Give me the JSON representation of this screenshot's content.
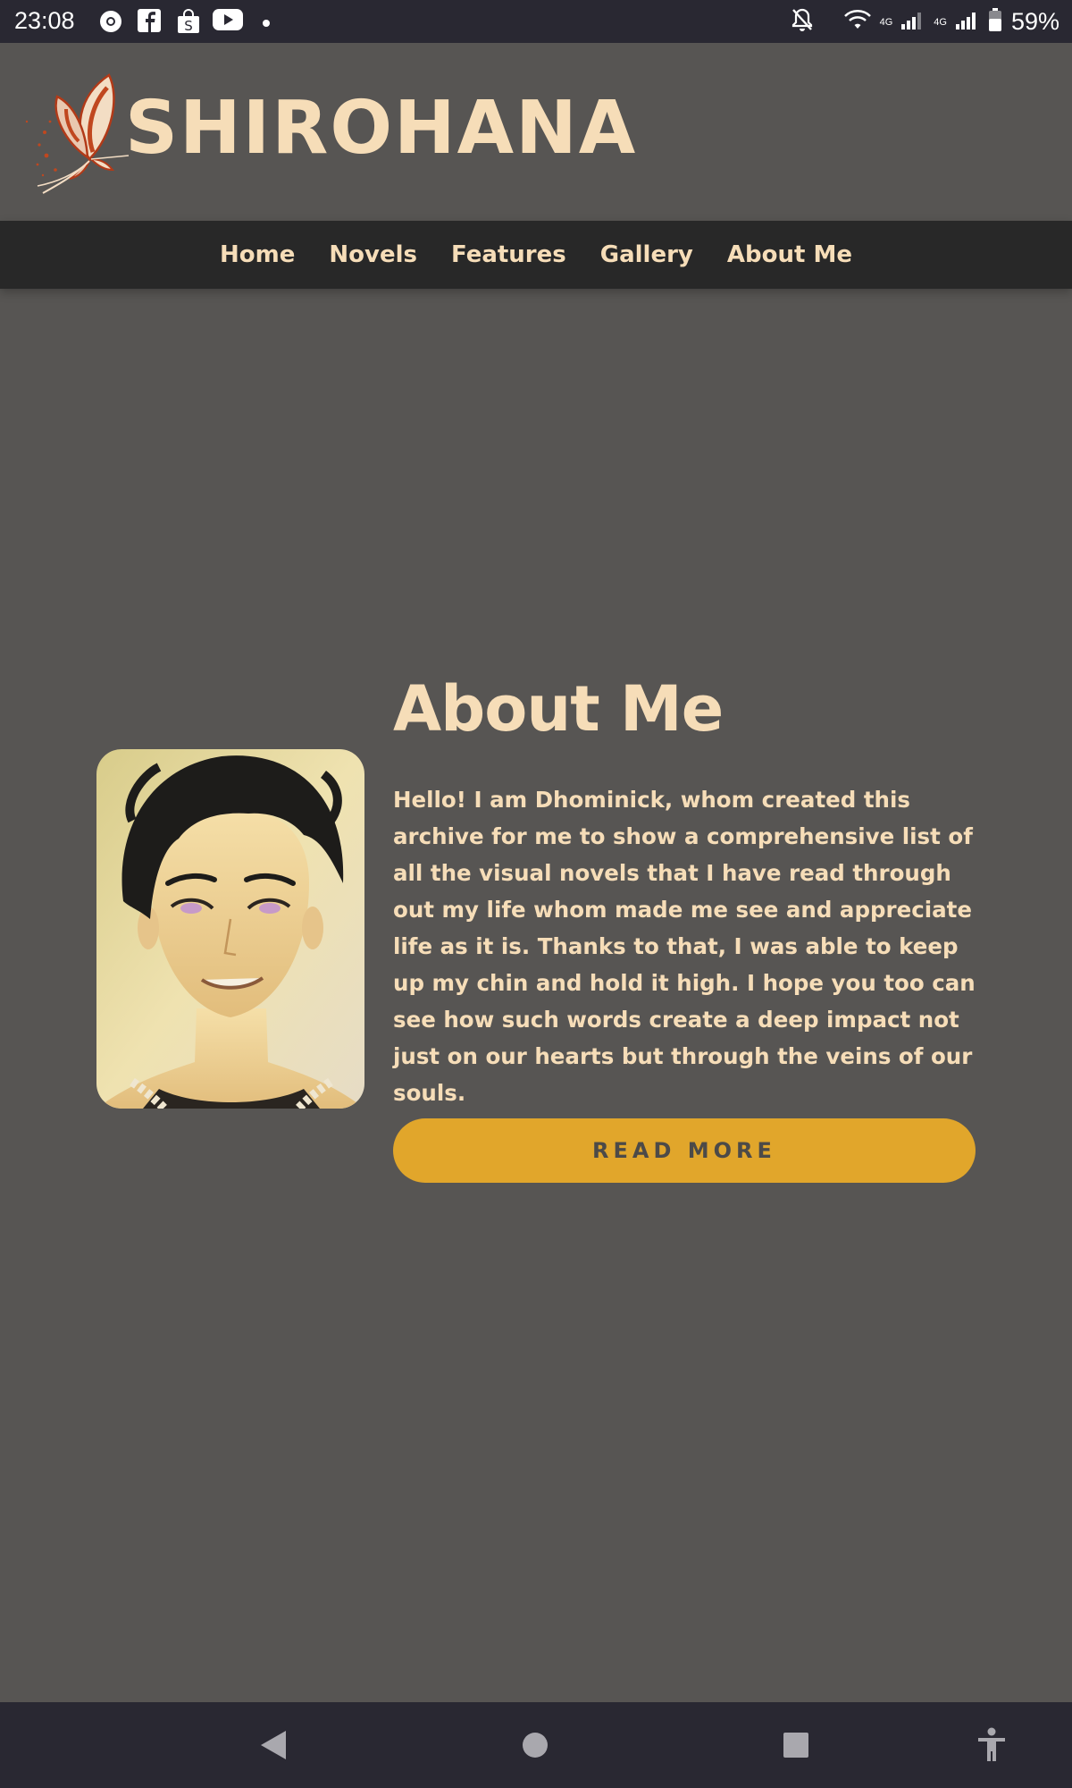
{
  "status_bar": {
    "time": "23:08",
    "network_label_1": "4G",
    "network_label_2": "4G",
    "battery_percent": "59%",
    "notification_icons": [
      "chrome-icon",
      "facebook-icon",
      "shop-icon",
      "youtube-icon",
      "dot-icon"
    ],
    "system_icons": [
      "bell-off-icon",
      "wifi-icon",
      "signal-icon",
      "signal-icon",
      "battery-icon"
    ]
  },
  "header": {
    "brand": "SHIROHANA",
    "logo_icon": "butterfly-icon"
  },
  "nav": {
    "items": [
      {
        "label": "Home"
      },
      {
        "label": "Novels"
      },
      {
        "label": "Features"
      },
      {
        "label": "Gallery"
      },
      {
        "label": "About Me"
      }
    ]
  },
  "about": {
    "title": "About Me",
    "body": "Hello! I am Dhominick, whom created this archive for me to show a comprehensive list of all the visual novels that I have read through out my life whom made me see and appreciate life as it is. Thanks to that, I was able to keep up my chin and hold it high. I hope you too can see how such words create a deep impact not just on our hearts but through the veins of our souls.",
    "button_label": "READ MORE"
  },
  "system_nav": {
    "buttons": [
      "back-icon",
      "home-icon",
      "recents-icon",
      "accessibility-icon"
    ]
  },
  "colors": {
    "page_background": "#575553",
    "nav_background": "#282828",
    "accent_text": "#f6ddb8",
    "button": "#e1a62b",
    "system_bars": "#292832"
  }
}
